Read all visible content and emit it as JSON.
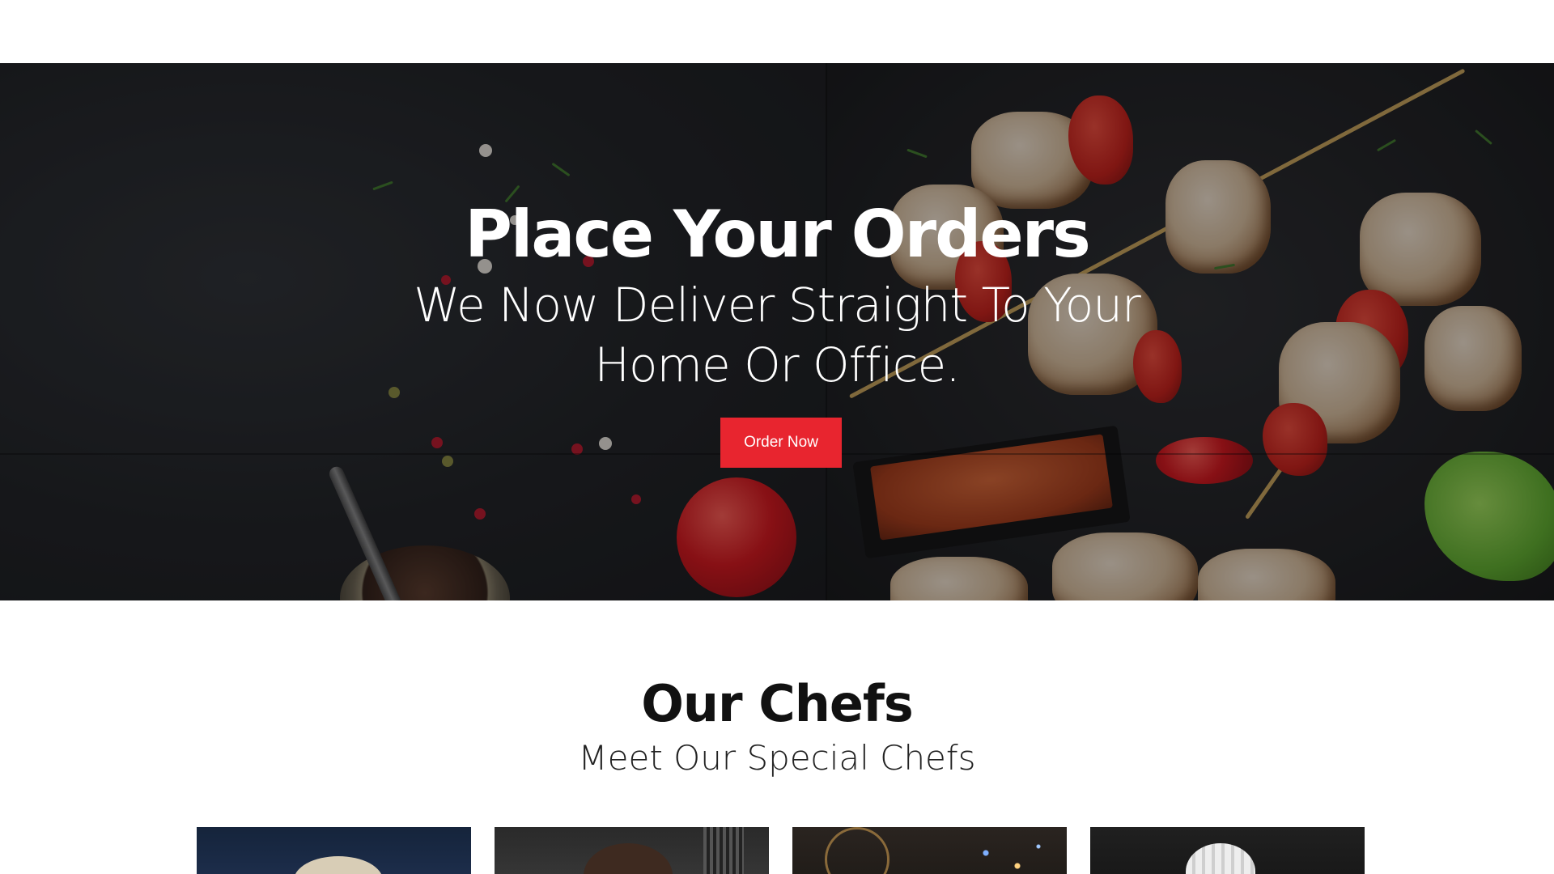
{
  "hero": {
    "title": "Place Your Orders",
    "subtitle": "We Now Deliver Straight To Your Home Or Office.",
    "button_label": "Order Now",
    "button_color": "#e8252f"
  },
  "chefs": {
    "title": "Our Chefs",
    "subtitle": "Meet Our Special Chefs"
  },
  "colors": {
    "accent": "#e8252f",
    "text_dark": "#111111",
    "background": "#ffffff"
  }
}
